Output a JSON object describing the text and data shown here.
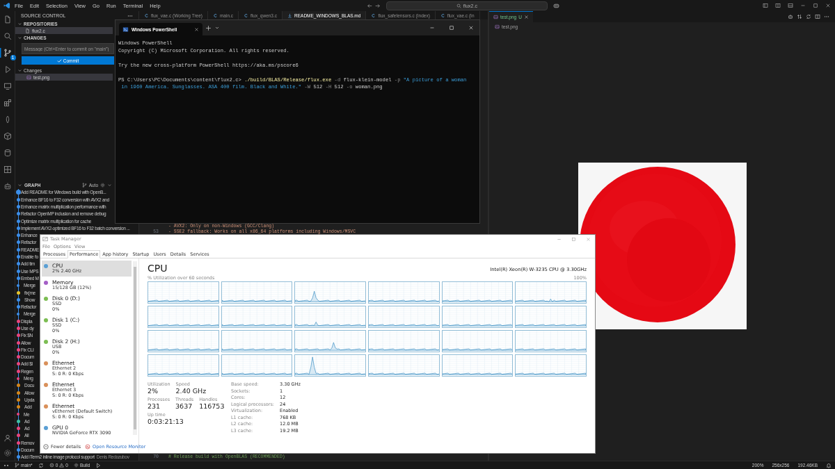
{
  "vscode": {
    "menu": [
      "File",
      "Edit",
      "Selection",
      "View",
      "Go",
      "Run",
      "Terminal",
      "Help"
    ],
    "search": "flux2.c",
    "activity": [
      {
        "kind": "files",
        "selected": false
      },
      {
        "kind": "search",
        "selected": false
      },
      {
        "kind": "source-control",
        "selected": true,
        "badge": "1"
      },
      {
        "kind": "run",
        "selected": false
      },
      {
        "kind": "remote",
        "selected": false
      },
      {
        "kind": "extensions",
        "selected": false
      },
      {
        "kind": "leaf",
        "selected": false
      },
      {
        "kind": "cube",
        "selected": false
      },
      {
        "kind": "database",
        "selected": false
      },
      {
        "kind": "grid",
        "selected": false
      },
      {
        "kind": "robot",
        "selected": false
      }
    ],
    "sidebar": {
      "title": "SOURCE CONTROL",
      "repositories_title": "REPOSITORIES",
      "repositories": [
        {
          "name": "flux2.c",
          "selected": true
        }
      ],
      "changes_title": "CHANGES",
      "message_placeholder": "Message (Ctrl+Enter to commit on \"main\")",
      "commit_label": "Commit",
      "changes_group": "Changes",
      "files": [
        {
          "name": "test.png",
          "selected": true
        }
      ]
    },
    "graph": {
      "title": "GRAPH",
      "auto": "Auto",
      "commits": [
        {
          "message": "Add README for Windows build with OpenB...",
          "kind": "head",
          "color": "#3b8eea"
        },
        {
          "message": "Enhance BF16 to F32 conversion with AVX2 and",
          "kind": "commit",
          "color": "#3b8eea"
        },
        {
          "message": "Enhance matrix multiplication performance with",
          "kind": "commit",
          "color": "#3b8eea"
        },
        {
          "message": "Refactor OpenMP inclusion and remove debug",
          "kind": "commit",
          "color": "#3b8eea"
        },
        {
          "message": "Optimize matrix multiplication for cache",
          "kind": "commit",
          "color": "#3b8eea"
        },
        {
          "message": "Implement AVX2-optimized BF16 to F32 batch conversion ...",
          "kind": "commit",
          "color": "#3b8eea"
        },
        {
          "message": "Enhance",
          "kind": "commit",
          "color": "#3b8eea"
        },
        {
          "message": "Refactor",
          "kind": "commit",
          "color": "#3b8eea"
        },
        {
          "message": "README",
          "kind": "commit",
          "color": "#3b8eea"
        },
        {
          "message": "Enable fo",
          "kind": "commit",
          "color": "#3b8eea"
        },
        {
          "message": "Add tim",
          "kind": "commit",
          "color": "#3b8eea"
        },
        {
          "message": "Use MPS",
          "kind": "commit",
          "color": "#3b8eea"
        },
        {
          "message": "Embed M",
          "kind": "commit",
          "color": "#3b8eea"
        },
        {
          "message": "Merge",
          "kind": "merge",
          "color": "#3b8eea"
        },
        {
          "message": "fix(me",
          "kind": "branch",
          "color": "#e5c22b"
        },
        {
          "message": "Show",
          "kind": "branch",
          "color": "#3b8eea"
        },
        {
          "message": "Refactor",
          "kind": "commit",
          "color": "#3b8eea"
        },
        {
          "message": "Merge",
          "kind": "merge",
          "color": "#3b8eea"
        },
        {
          "message": "Displa",
          "kind": "commit",
          "color": "#e8457c"
        },
        {
          "message": "Use dy",
          "kind": "commit",
          "color": "#e8457c"
        },
        {
          "message": "Fix $N",
          "kind": "commit",
          "color": "#e8457c"
        },
        {
          "message": "Allow",
          "kind": "commit",
          "color": "#e8457c"
        },
        {
          "message": "Fix CLI",
          "kind": "commit",
          "color": "#e8457c"
        },
        {
          "message": "Docum",
          "kind": "commit",
          "color": "#e8457c"
        },
        {
          "message": "Add $l",
          "kind": "commit",
          "color": "#e8457c"
        },
        {
          "message": "Regen",
          "kind": "commit",
          "color": "#e8457c"
        },
        {
          "message": "Merg",
          "kind": "merge",
          "color": "#e8457c"
        },
        {
          "message": "Docu",
          "kind": "branch",
          "color": "#d4861a"
        },
        {
          "message": "Allow",
          "kind": "branch",
          "color": "#d4861a"
        },
        {
          "message": "Upda",
          "kind": "branch",
          "color": "#d4861a"
        },
        {
          "message": "Add",
          "kind": "branch",
          "color": "#d4861a"
        },
        {
          "message": "Me",
          "kind": "merge",
          "color": "#e8457c"
        },
        {
          "message": "Ad",
          "kind": "branch",
          "color": "#3fc1a5"
        },
        {
          "message": "Ad",
          "kind": "branch",
          "color": "#e8457c"
        },
        {
          "message": "All",
          "kind": "branch",
          "color": "#e8457c"
        },
        {
          "message": "Remov",
          "kind": "commit",
          "color": "#e8457c"
        },
        {
          "message": "Docum",
          "kind": "commit",
          "color": "#3b8eea"
        },
        {
          "message": "Add iTerm2 inline image protocol support",
          "author": "Denis Redozubov",
          "kind": "commit",
          "color": "#3b8eea"
        }
      ]
    },
    "tabs": [
      {
        "label": "flux_vae.c (Working Tree)",
        "kind": "c",
        "selected": false
      },
      {
        "label": "main.c",
        "kind": "c",
        "selected": false
      },
      {
        "label": "flux_qwen3.c",
        "kind": "c",
        "selected": false
      },
      {
        "label": "README_WINDOWS_BLAS.md",
        "kind": "markdown",
        "selected": true
      },
      {
        "label": "flux_safetensors.c (Index)",
        "kind": "c",
        "selected": false
      },
      {
        "label": "flux_vae.c (In",
        "kind": "c",
        "selected": false
      }
    ],
    "code_top": [
      {
        "text": "- AVX2: Only on non-Windows (GCC/Clang)"
      },
      {
        "number": "53",
        "text": "- SSE2 fallback: Works on all x86_64 platforms including Windows/MSVC"
      }
    ],
    "code_bottom": [
      {
        "number": "70",
        "text": "# Release build with OpenBLAS (RECOMMENDED)"
      }
    ],
    "image_tab": {
      "label": "test.png",
      "badge": "U",
      "selected": true
    },
    "breadcrumb": "test.png",
    "image": {
      "kind": "picture"
    },
    "status_bar": {
      "branch": "main*",
      "errors": "0",
      "warnings": "0",
      "task": "Build",
      "zoom": "200%",
      "size": "256x256",
      "file_size": "192.46KB"
    }
  },
  "powershell": {
    "title": "Windows PowerShell",
    "blocks": [
      [
        [
          {
            "kind": "plain",
            "text": "Windows PowerShell"
          }
        ],
        [
          {
            "kind": "plain",
            "text": "Copyright (C) Microsoft Corporation. All rights reserved."
          }
        ]
      ],
      [
        [
          {
            "kind": "plain",
            "text": "Try the new cross-platform PowerShell https://aka.ms/pscore6"
          }
        ]
      ],
      [
        [
          {
            "kind": "plain",
            "text": "PS C:\\Users\\PC\\Documents\\content\\flux2.c> "
          },
          {
            "kind": "command",
            "text": "./build/BLAS/Release/flux.exe"
          },
          {
            "kind": "param",
            "text": " -d"
          },
          {
            "kind": "plain",
            "text": " flux-klein-model"
          },
          {
            "kind": "param",
            "text": " -p"
          },
          {
            "kind": "string",
            "text": " \"A picture of a woman"
          }
        ],
        [
          {
            "kind": "string",
            "text": " in 1960 America. Sunglasses. ASA 400 film. Black and White.\""
          },
          {
            "kind": "param",
            "text": " -W"
          },
          {
            "kind": "plain",
            "text": " 512"
          },
          {
            "kind": "param",
            "text": " -H"
          },
          {
            "kind": "plain",
            "text": " 512"
          },
          {
            "kind": "param",
            "text": " -o"
          },
          {
            "kind": "plain",
            "text": " woman.png"
          }
        ]
      ]
    ]
  },
  "task_manager": {
    "title": "Task Manager",
    "menu": [
      "File",
      "Options",
      "View"
    ],
    "tabs": [
      {
        "label": "Processes",
        "selected": false
      },
      {
        "label": "Performance",
        "selected": true
      },
      {
        "label": "App history",
        "selected": false
      },
      {
        "label": "Startup",
        "selected": false
      },
      {
        "label": "Users",
        "selected": false
      },
      {
        "label": "Details",
        "selected": false
      },
      {
        "label": "Services",
        "selected": false
      }
    ],
    "resources": [
      {
        "name": "CPU",
        "lines": [
          "2% 2.40 GHz"
        ],
        "color": "#5a9fd4",
        "selected": true
      },
      {
        "name": "Memory",
        "lines": [
          "15/128 GB (12%)"
        ],
        "color": "#a45fc6",
        "selected": false
      },
      {
        "name": "Disk 0 (D:)",
        "lines": [
          "SSD",
          "0%"
        ],
        "color": "#7cbd53",
        "selected": false
      },
      {
        "name": "Disk 1 (C:)",
        "lines": [
          "SSD",
          "0%"
        ],
        "color": "#7cbd53",
        "selected": false
      },
      {
        "name": "Disk 2 (H:)",
        "lines": [
          "USB",
          "0%"
        ],
        "color": "#7cbd53",
        "selected": false
      },
      {
        "name": "Ethernet",
        "lines": [
          "Ethernet 2",
          "S: 0 R: 0 Kbps"
        ],
        "color": "#d9905a",
        "selected": false
      },
      {
        "name": "Ethernet",
        "lines": [
          "Ethernet 3",
          "S: 0 R: 0 Kbps"
        ],
        "color": "#d9905a",
        "selected": false
      },
      {
        "name": "Ethernet",
        "lines": [
          "vEthernet (Default Switch)",
          "S: 0 R: 0 Kbps"
        ],
        "color": "#d9905a",
        "selected": false
      },
      {
        "name": "GPU 0",
        "lines": [
          "NVIDIA GeForce RTX 3090"
        ],
        "color": "#5a9fd4",
        "selected": false
      }
    ],
    "fewer_details": "Fewer details",
    "resource_monitor": "Open Resource Monitor",
    "heading": "CPU",
    "model": "Intel(R) Xeon(R) W-3235 CPU @ 3.30GHz",
    "graph_caption": "% Utilization over 60 seconds",
    "graph_max": "100%",
    "stats": [
      [
        {
          "label": "Utilization",
          "value": "2%"
        },
        {
          "label": "Speed",
          "value": "2.40 GHz"
        }
      ],
      [
        {
          "label": "Processes",
          "value": "231"
        },
        {
          "label": "Threads",
          "value": "3637"
        },
        {
          "label": "Handles",
          "value": "116753"
        }
      ],
      [
        {
          "label": "Up time",
          "value": "0:03:21:13"
        }
      ]
    ],
    "specs": [
      {
        "label": "Base speed:",
        "value": "3.30 GHz"
      },
      {
        "label": "Sockets:",
        "value": "1"
      },
      {
        "label": "Cores:",
        "value": "12"
      },
      {
        "label": "Logical processors:",
        "value": "24"
      },
      {
        "label": "Virtualization:",
        "value": "Enabled"
      },
      {
        "label": "L1 cache:",
        "value": "768 KB"
      },
      {
        "label": "L2 cache:",
        "value": "12.0 MB"
      },
      {
        "label": "L3 cache:",
        "value": "19.2 MB"
      }
    ]
  }
}
